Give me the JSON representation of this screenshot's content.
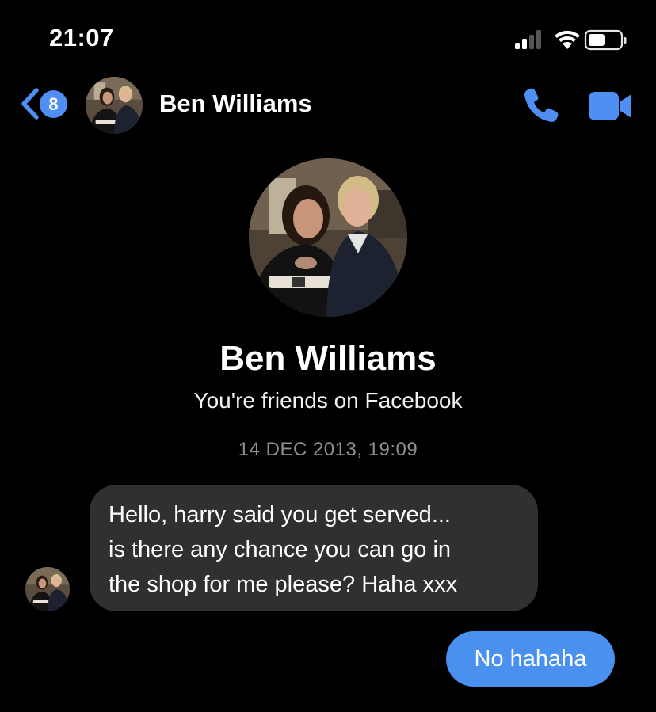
{
  "status_bar": {
    "time": "21:07",
    "icons": [
      "signal-icon",
      "wifi-icon",
      "battery-icon"
    ]
  },
  "header": {
    "back_icon": "chevron-left-icon",
    "unread_count": "8",
    "contact_name": "Ben Williams",
    "actions": [
      "phone-call-icon",
      "video-call-icon"
    ]
  },
  "profile": {
    "name": "Ben Williams",
    "subtitle": "You're friends on Facebook"
  },
  "conversation": {
    "timestamp": "14 DEC 2013, 19:09",
    "messages": [
      {
        "direction": "incoming",
        "lines": [
          "Hello, harry said you get served...",
          "is there any chance you can go in",
          "the shop for me please? Haha xxx"
        ]
      },
      {
        "direction": "outgoing",
        "text": "No hahaha"
      }
    ]
  },
  "colors": {
    "background": "#000000",
    "accent": "#4f8ff3",
    "incoming_bubble": "#303032",
    "outgoing_bubble": "#4a90ee",
    "timestamp": "#8e8e93"
  }
}
